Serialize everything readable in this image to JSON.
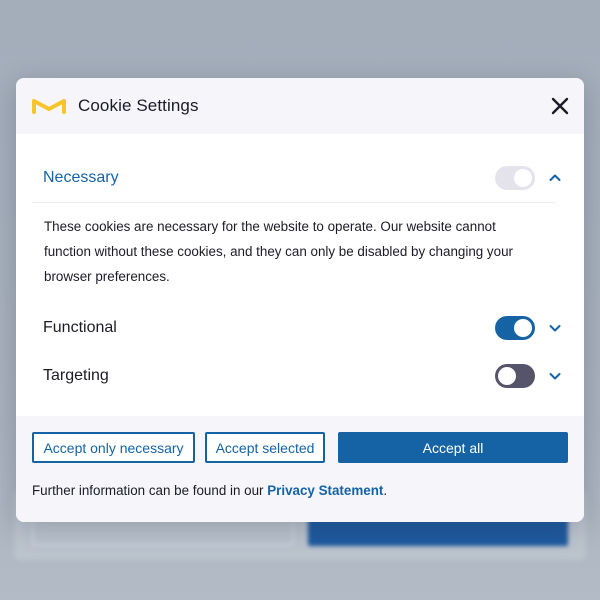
{
  "dialog": {
    "title": "Cookie Settings",
    "logo_icon": "brand-m-logo-icon",
    "close_icon": "close-icon"
  },
  "categories": [
    {
      "label": "Necessary",
      "toggle_state": "on-disabled",
      "expanded": true,
      "chevron_icon": "chevron-up-icon",
      "description": "These cookies are necessary for the website to operate. Our website cannot function without these cookies, and they can only be disabled by changing your browser preferences."
    },
    {
      "label": "Functional",
      "toggle_state": "on",
      "expanded": false,
      "chevron_icon": "chevron-down-icon"
    },
    {
      "label": "Targeting",
      "toggle_state": "off",
      "expanded": false,
      "chevron_icon": "chevron-down-icon"
    }
  ],
  "footer": {
    "accept_necessary_label": "Accept only necessary",
    "accept_selected_label": "Accept selected",
    "accept_all_label": "Accept all",
    "info_text": "Further information can be found in our ",
    "privacy_link_label": "Privacy Statement",
    "info_suffix": "."
  },
  "colors": {
    "accent": "#1562a5",
    "logo_yellow": "#f7c52a",
    "toggle_off": "#55546a",
    "toggle_disabled": "#e4e3ec",
    "header_bg": "#f5f5fa"
  }
}
